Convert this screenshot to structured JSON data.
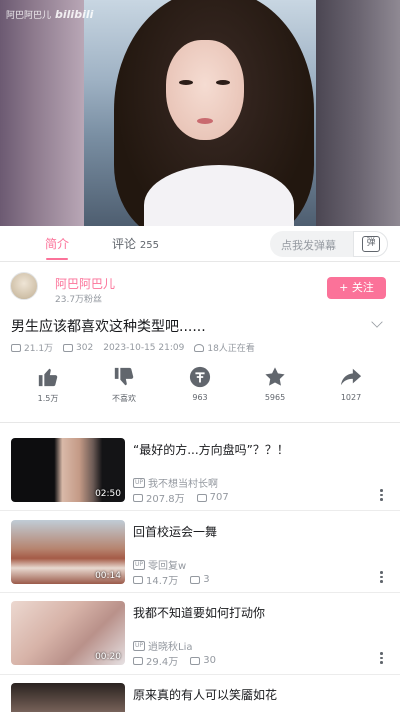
{
  "player": {
    "watermark_user": "阿巴阿巴儿",
    "watermark_brand": "bilibili"
  },
  "tabs": {
    "intro": "简介",
    "comments": "评论",
    "comments_count": "255",
    "danmaku_placeholder": "点我发弹幕",
    "danmaku_toggle": "弹"
  },
  "uploader": {
    "name": "阿巴阿巴儿",
    "fans": "23.7万粉丝",
    "follow_label": "+ 关注"
  },
  "video": {
    "title": "男生应该都喜欢这种类型吧......",
    "views": "21.1万",
    "danmaku": "302",
    "date": "2023-10-15 21:09",
    "watching": "18人正在看"
  },
  "actions": [
    {
      "name": "like",
      "label": "1.5万"
    },
    {
      "name": "dislike",
      "label": "不喜欢"
    },
    {
      "name": "coin",
      "label": "963"
    },
    {
      "name": "favorite",
      "label": "5965"
    },
    {
      "name": "share",
      "label": "1027"
    }
  ],
  "recommendations": [
    {
      "title": "“最好的方...方向盘吗”？？！",
      "up": "我不想当村长啊",
      "views": "207.8万",
      "danmaku": "707",
      "duration": "02:50"
    },
    {
      "title": "回首校运会一舞",
      "up": "零回复w",
      "views": "14.7万",
      "danmaku": "3",
      "duration": "00:14"
    },
    {
      "title": "我都不知道要如何打动你",
      "up": "逍晓秋Lia",
      "views": "29.4万",
      "danmaku": "30",
      "duration": "00:20"
    },
    {
      "title": "原来真的有人可以笑靥如花",
      "up": "",
      "views": "",
      "danmaku": "",
      "duration": ""
    }
  ],
  "colors": {
    "accent": "#fb7299",
    "text_secondary": "#9499a0"
  }
}
